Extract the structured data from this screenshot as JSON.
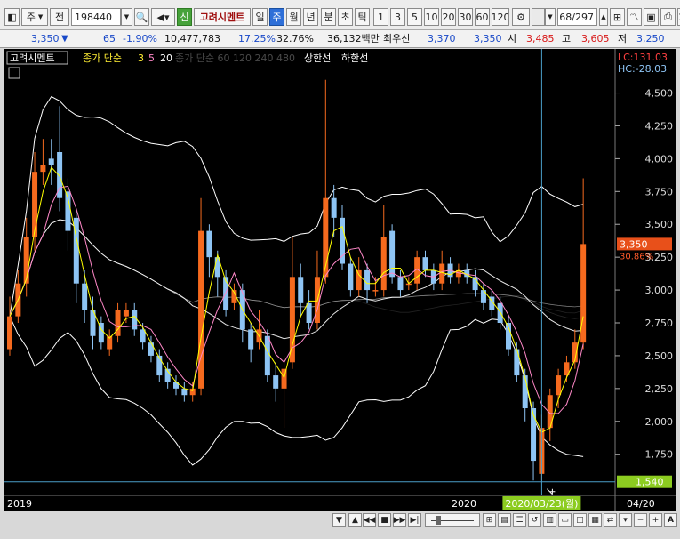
{
  "toolbar": {
    "market": "주",
    "prev_label": "전",
    "code": "198440",
    "sin_label": "신",
    "company": "고려시멘트",
    "periods": [
      "일",
      "주",
      "월",
      "년"
    ],
    "active_period": "주",
    "minute_label": "분",
    "second_label": "초",
    "tick_label": "틱",
    "intervals": [
      "1",
      "3",
      "5",
      "10",
      "20",
      "30",
      "60",
      "120"
    ],
    "page_indicator": "68/297"
  },
  "quote": {
    "price": "3,350",
    "down_mark": "▼",
    "change": "65",
    "change_pct": "-1.90%",
    "volume": "10,477,783",
    "ratio1": "17.25%",
    "ratio2": "32.76%",
    "amount": "36,132백만",
    "priority_label": "최우선",
    "priority_ask": "3,370",
    "priority_bid": "3,350",
    "open_label": "시",
    "open": "3,485",
    "high_label": "고",
    "high": "3,605",
    "low_label": "저",
    "low": "3,250"
  },
  "legend": {
    "stock": "고려시멘트",
    "ma_label": "종가 단순",
    "ma_periods": [
      "3",
      "5",
      "20"
    ],
    "faded": "종가 단순 60 120 240 480",
    "upper_limit": "상한선",
    "lower_limit": "하한선"
  },
  "side": {
    "lc": "LC:131.03",
    "hc": "HC:-28.03",
    "current_pct": "30.86%"
  },
  "xaxis": {
    "label_2019": "2019",
    "label_2020": "2020",
    "crosshair_date": "2020/03/23(월)",
    "right_label": "04/20"
  },
  "colors": {
    "up": "#f56a1e",
    "down": "#8ec4f4",
    "ma3": "#ffff00",
    "ma5": "#ff88c8",
    "band": "#ffffff",
    "crosshair": "#4a9ec8",
    "cur_bg": "#e8501a",
    "cross_bg": "#8ccc20"
  },
  "chart_data": {
    "type": "candlestick",
    "title": "고려시멘트",
    "ylim": [
      1450,
      4700
    ],
    "yticks": [
      1750,
      2000,
      2250,
      2500,
      2750,
      3000,
      3250,
      3500,
      3750,
      4000,
      4250,
      4500
    ],
    "current_price": 3350,
    "crosshair_price": 1540,
    "crosshair_index": 64,
    "candles": [
      {
        "o": 2550,
        "c": 2800,
        "h": 2950,
        "l": 2500
      },
      {
        "o": 2800,
        "c": 3050,
        "h": 3150,
        "l": 2750
      },
      {
        "o": 3050,
        "c": 3400,
        "h": 3550,
        "l": 2950
      },
      {
        "o": 3400,
        "c": 3900,
        "h": 4050,
        "l": 3300
      },
      {
        "o": 3900,
        "c": 3950,
        "h": 4150,
        "l": 3800
      },
      {
        "o": 4000,
        "c": 3950,
        "h": 4150,
        "l": 3800
      },
      {
        "o": 4050,
        "c": 3700,
        "h": 4400,
        "l": 3600
      },
      {
        "o": 3750,
        "c": 3450,
        "h": 3850,
        "l": 3300
      },
      {
        "o": 3550,
        "c": 3050,
        "h": 3600,
        "l": 2900
      },
      {
        "o": 3050,
        "c": 2850,
        "h": 3150,
        "l": 2750
      },
      {
        "o": 2850,
        "c": 2650,
        "h": 2950,
        "l": 2550
      },
      {
        "o": 2750,
        "c": 2600,
        "h": 2800,
        "l": 2550
      },
      {
        "o": 2550,
        "c": 2650,
        "h": 2700,
        "l": 2500
      },
      {
        "o": 2650,
        "c": 2850,
        "h": 2900,
        "l": 2600
      },
      {
        "o": 2800,
        "c": 2850,
        "h": 2900,
        "l": 2750
      },
      {
        "o": 2850,
        "c": 2700,
        "h": 2900,
        "l": 2650
      },
      {
        "o": 2700,
        "c": 2600,
        "h": 2750,
        "l": 2550
      },
      {
        "o": 2600,
        "c": 2500,
        "h": 2650,
        "l": 2450
      },
      {
        "o": 2500,
        "c": 2350,
        "h": 2550,
        "l": 2300
      },
      {
        "o": 2400,
        "c": 2300,
        "h": 2450,
        "l": 2250
      },
      {
        "o": 2300,
        "c": 2250,
        "h": 2350,
        "l": 2200
      },
      {
        "o": 2250,
        "c": 2200,
        "h": 2300,
        "l": 2150
      },
      {
        "o": 2200,
        "c": 2250,
        "h": 2300,
        "l": 2150
      },
      {
        "o": 2250,
        "c": 3450,
        "h": 3700,
        "l": 2200
      },
      {
        "o": 3450,
        "c": 3250,
        "h": 3500,
        "l": 3100
      },
      {
        "o": 3250,
        "c": 3100,
        "h": 3300,
        "l": 2950
      },
      {
        "o": 3100,
        "c": 2850,
        "h": 3150,
        "l": 2800
      },
      {
        "o": 2900,
        "c": 3000,
        "h": 3050,
        "l": 2850
      },
      {
        "o": 3000,
        "c": 2700,
        "h": 3050,
        "l": 2600
      },
      {
        "o": 2700,
        "c": 2550,
        "h": 2750,
        "l": 2450
      },
      {
        "o": 2600,
        "c": 2700,
        "h": 2850,
        "l": 2550
      },
      {
        "o": 2650,
        "c": 2350,
        "h": 2700,
        "l": 2300
      },
      {
        "o": 2350,
        "c": 2250,
        "h": 2450,
        "l": 2150
      },
      {
        "o": 2250,
        "c": 2400,
        "h": 2500,
        "l": 1950
      },
      {
        "o": 2450,
        "c": 3100,
        "h": 3400,
        "l": 2400
      },
      {
        "o": 3100,
        "c": 2900,
        "h": 3200,
        "l": 2800
      },
      {
        "o": 2900,
        "c": 2750,
        "h": 3000,
        "l": 2700
      },
      {
        "o": 2750,
        "c": 3100,
        "h": 3300,
        "l": 2700
      },
      {
        "o": 3100,
        "c": 3700,
        "h": 4600,
        "l": 3050
      },
      {
        "o": 3700,
        "c": 3550,
        "h": 3800,
        "l": 3400
      },
      {
        "o": 3550,
        "c": 3200,
        "h": 3650,
        "l": 3150
      },
      {
        "o": 3200,
        "c": 3000,
        "h": 3250,
        "l": 2950
      },
      {
        "o": 3000,
        "c": 3150,
        "h": 3250,
        "l": 2950
      },
      {
        "o": 3150,
        "c": 3000,
        "h": 3200,
        "l": 2900
      },
      {
        "o": 3000,
        "c": 3000,
        "h": 3100,
        "l": 2950
      },
      {
        "o": 3000,
        "c": 3400,
        "h": 3650,
        "l": 2950
      },
      {
        "o": 3450,
        "c": 3100,
        "h": 3500,
        "l": 3050
      },
      {
        "o": 3100,
        "c": 3000,
        "h": 3150,
        "l": 2950
      },
      {
        "o": 3050,
        "c": 3050,
        "h": 3100,
        "l": 3000
      },
      {
        "o": 3050,
        "c": 3250,
        "h": 3300,
        "l": 3000
      },
      {
        "o": 3250,
        "c": 3150,
        "h": 3300,
        "l": 3100
      },
      {
        "o": 3150,
        "c": 3050,
        "h": 3200,
        "l": 3000
      },
      {
        "o": 3050,
        "c": 3200,
        "h": 3300,
        "l": 3000
      },
      {
        "o": 3200,
        "c": 3100,
        "h": 3250,
        "l": 3050
      },
      {
        "o": 3100,
        "c": 3150,
        "h": 3200,
        "l": 3050
      },
      {
        "o": 3150,
        "c": 3100,
        "h": 3200,
        "l": 3050
      },
      {
        "o": 3100,
        "c": 3000,
        "h": 3150,
        "l": 2950
      },
      {
        "o": 3000,
        "c": 2900,
        "h": 3050,
        "l": 2850
      },
      {
        "o": 2950,
        "c": 2850,
        "h": 3000,
        "l": 2800
      },
      {
        "o": 2900,
        "c": 2750,
        "h": 2950,
        "l": 2700
      },
      {
        "o": 2750,
        "c": 2550,
        "h": 2800,
        "l": 2500
      },
      {
        "o": 2550,
        "c": 2350,
        "h": 2600,
        "l": 2300
      },
      {
        "o": 2350,
        "c": 2100,
        "h": 2400,
        "l": 2000
      },
      {
        "o": 2100,
        "c": 1700,
        "h": 2150,
        "l": 1550
      },
      {
        "o": 1600,
        "c": 1950,
        "h": 2050,
        "l": 1550
      },
      {
        "o": 1950,
        "c": 2200,
        "h": 2250,
        "l": 1850
      },
      {
        "o": 2200,
        "c": 2350,
        "h": 2400,
        "l": 2100
      },
      {
        "o": 2350,
        "c": 2450,
        "h": 2500,
        "l": 2300
      },
      {
        "o": 2450,
        "c": 2600,
        "h": 2700,
        "l": 2400
      },
      {
        "o": 2600,
        "c": 3350,
        "h": 3850,
        "l": 2550
      }
    ]
  }
}
